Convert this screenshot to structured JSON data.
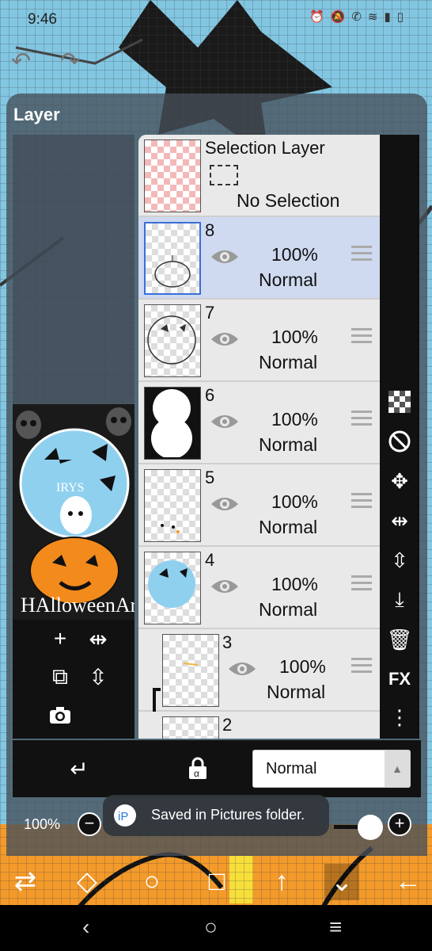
{
  "status_bar": {
    "time": "9:46"
  },
  "panel": {
    "title": "Layer"
  },
  "selection_layer": {
    "label": "Selection Layer",
    "state": "No Selection"
  },
  "layers": [
    {
      "number": "8",
      "opacity": "100%",
      "blend": "Normal",
      "selected": true
    },
    {
      "number": "7",
      "opacity": "100%",
      "blend": "Normal",
      "selected": false
    },
    {
      "number": "6",
      "opacity": "100%",
      "blend": "Normal",
      "selected": false
    },
    {
      "number": "5",
      "opacity": "100%",
      "blend": "Normal",
      "selected": false
    },
    {
      "number": "4",
      "opacity": "100%",
      "blend": "Normal",
      "selected": false
    },
    {
      "number": "3",
      "opacity": "100%",
      "blend": "Normal",
      "selected": false
    },
    {
      "number": "2"
    }
  ],
  "right_tools": {
    "fx_label": "FX"
  },
  "blend_mode": {
    "selected": "Normal"
  },
  "opacity_row": {
    "zoom": "100%"
  },
  "toast": {
    "message": "Saved in Pictures folder."
  },
  "preview": {
    "caption": "HAlloweenArt",
    "art_text": "IRYS"
  },
  "colors": {
    "accent": "#3a6fd8",
    "selected_row": "#cfdaf0",
    "canvas_sky": "#82c6e2",
    "canvas_ground": "#f39a2a"
  }
}
